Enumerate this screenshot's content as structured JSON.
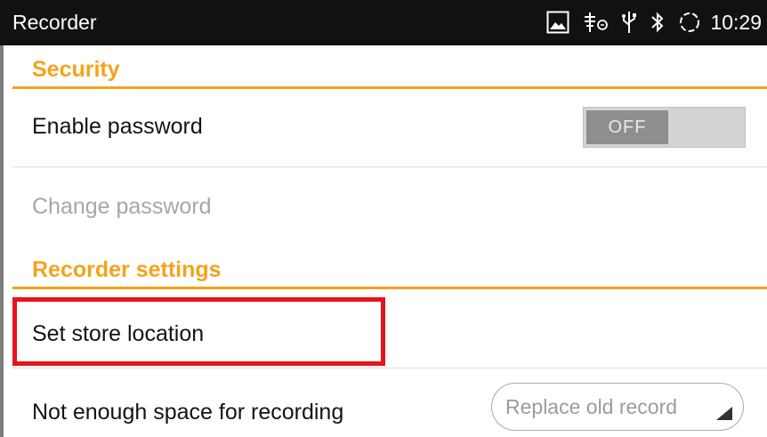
{
  "status_bar": {
    "app_title": "Recorder",
    "time": "10:29",
    "icons": [
      "image-icon",
      "usb-debug-icon",
      "usb-icon",
      "bluetooth-icon",
      "sync-icon"
    ]
  },
  "sections": {
    "security": {
      "title": "Security",
      "enable_password": {
        "label": "Enable password",
        "toggle_state": "OFF"
      },
      "change_password": {
        "label": "Change password",
        "enabled": false
      }
    },
    "recorder_settings": {
      "title": "Recorder settings",
      "set_store_location": {
        "label": "Set store location"
      },
      "not_enough_space": {
        "label": "Not enough space for recording",
        "selected_value": "Replace old record"
      }
    }
  },
  "colors": {
    "accent": "#f4a31c",
    "highlight": "#e6141b",
    "status_bar_bg": "#111111"
  }
}
